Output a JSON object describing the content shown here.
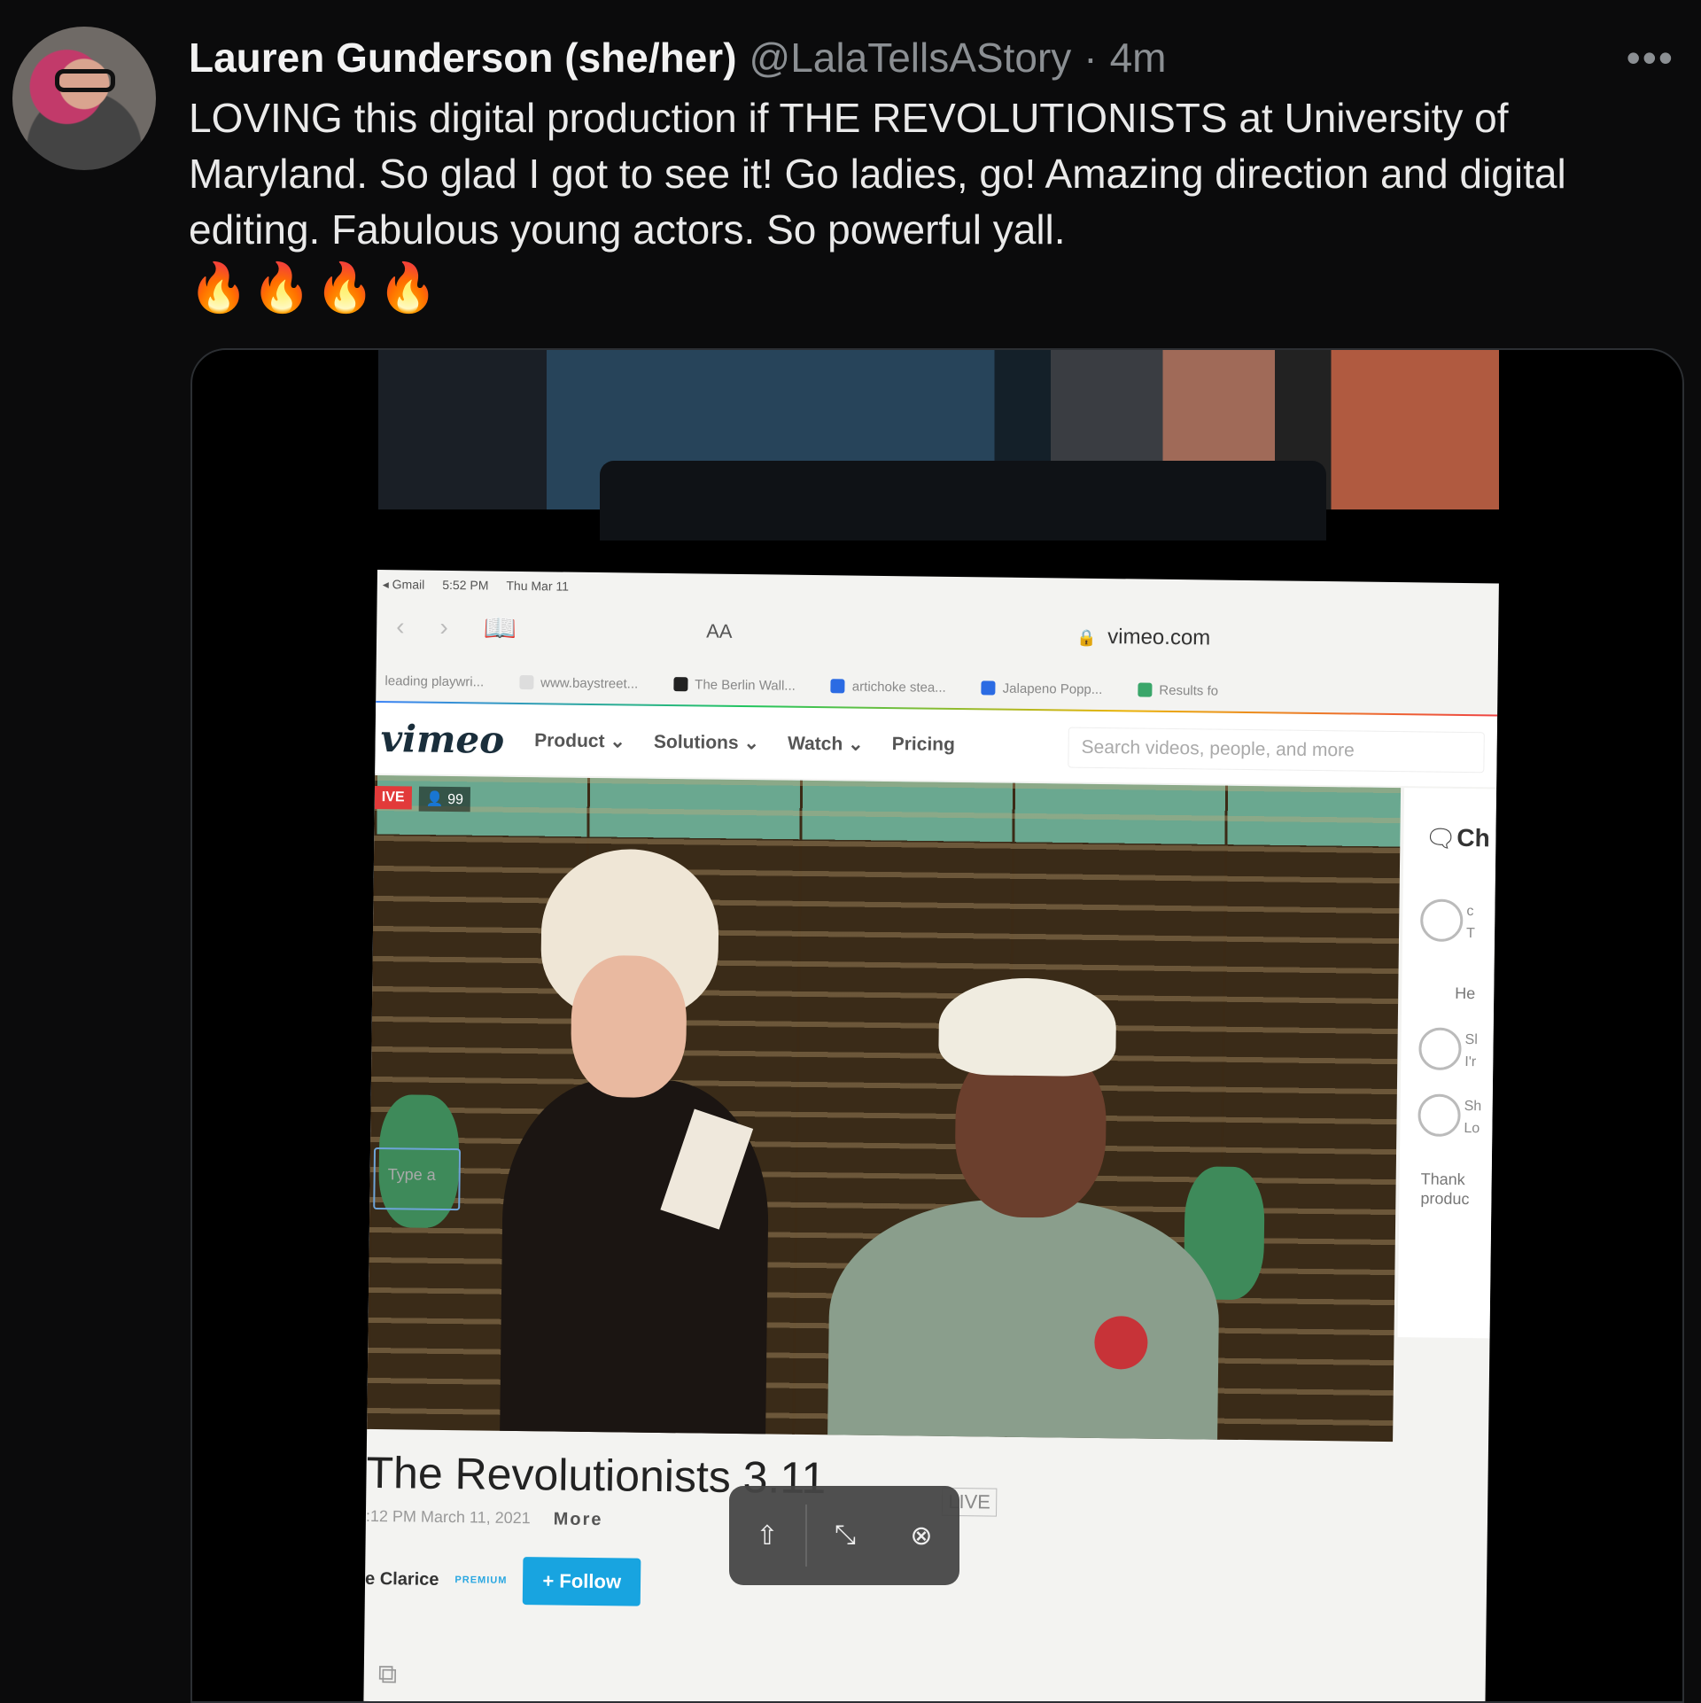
{
  "tweet": {
    "author_name": "Lauren Gunderson (she/her)",
    "handle": "@LalaTellsAStory",
    "separator": "·",
    "time": "4m",
    "more_label": "•••",
    "text": "LOVING this digital production if THE REVOLUTIONISTS at University of Maryland.  So glad I got to see it! Go ladies, go! Amazing direction and digital editing. Fabulous young actors. So powerful yall.",
    "emojis": "🔥🔥🔥🔥"
  },
  "media": {
    "status_bar": {
      "app": "◂ Gmail",
      "time": "5:52 PM",
      "date": "Thu Mar 11"
    },
    "browser": {
      "back": "‹",
      "forward": "›",
      "reader_icon": "📖",
      "text_size": "AA",
      "lock": "🔒",
      "url": "vimeo.com",
      "bookmarks": [
        "leading playwri...",
        "www.baystreet...",
        "The Berlin Wall...",
        "artichoke stea...",
        "Jalapeno Popp...",
        "Results fo"
      ]
    },
    "vimeo": {
      "logo": "vimeo",
      "nav": [
        "Product ⌄",
        "Solutions ⌄",
        "Watch ⌄",
        "Pricing"
      ],
      "search_placeholder": "Search videos, people, and more",
      "live_badge": "IVE",
      "viewer_count": "👤 99",
      "chat": {
        "icon": "🗨",
        "title": "Ch",
        "line1": "c",
        "line2": "T",
        "msg1": "He",
        "line3": "Sl",
        "line4": "I'r",
        "line5": "Sh",
        "line6": "Lo",
        "msg2": "Thank\nproduc",
        "input_placeholder": "Type a"
      },
      "video_title": "The Revolutionists 3.11",
      "live_tag": "LIVE",
      "date": ":12 PM March 11, 2021",
      "more": "More",
      "channel": "e Clarice",
      "premium": "PREMIUM",
      "follow": "+ Follow",
      "copy_icon": "⧉"
    },
    "controls": {
      "share": "⇧",
      "minimize": "⤡",
      "close": "⊗"
    }
  }
}
